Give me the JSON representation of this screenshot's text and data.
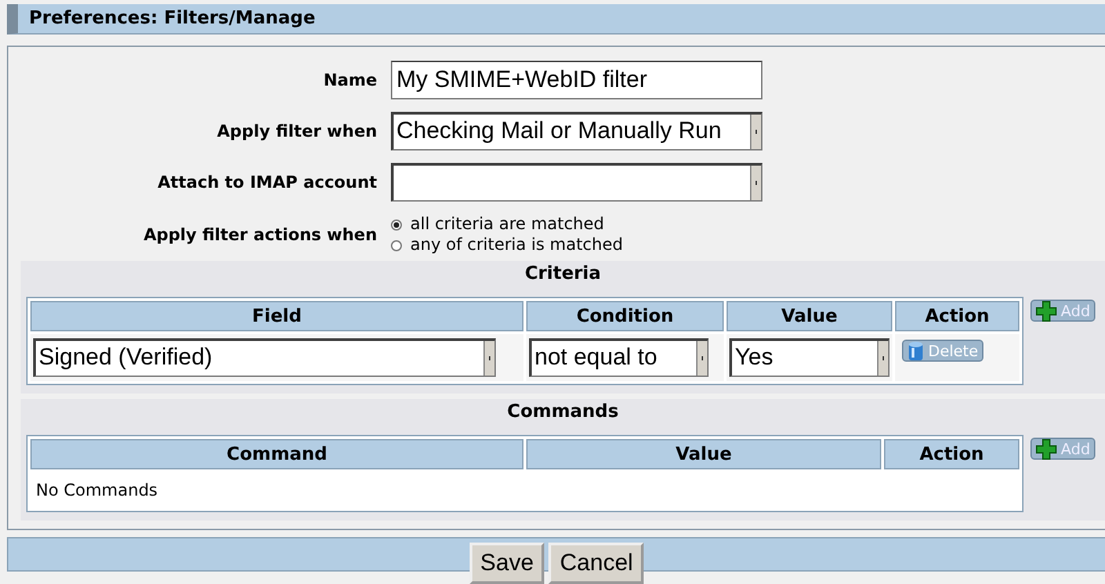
{
  "header": {
    "title": "Preferences: Filters/Manage"
  },
  "form": {
    "name": {
      "label": "Name",
      "value": "My SMIME+WebID filter"
    },
    "apply_when": {
      "label": "Apply filter when",
      "value": "Checking Mail or Manually Run"
    },
    "imap_account": {
      "label": "Attach to IMAP account"
    },
    "match": {
      "label": "Apply filter actions when",
      "options": [
        {
          "label": "all criteria are matched",
          "selected": true
        },
        {
          "label": "any of criteria is matched",
          "selected": false
        }
      ]
    }
  },
  "criteria": {
    "title": "Criteria",
    "columns": [
      "Field",
      "Condition",
      "Value",
      "Action"
    ],
    "rows": [
      {
        "field": "Signed (Verified)",
        "condition": "not equal to",
        "value": "Yes",
        "action": "Delete"
      }
    ],
    "add_button": "Add"
  },
  "commands": {
    "title": "Commands",
    "columns": [
      "Command",
      "Value",
      "Action"
    ],
    "empty_text": "No Commands",
    "add_button": "Add"
  },
  "buttons": [
    "Save",
    "Cancel"
  ]
}
